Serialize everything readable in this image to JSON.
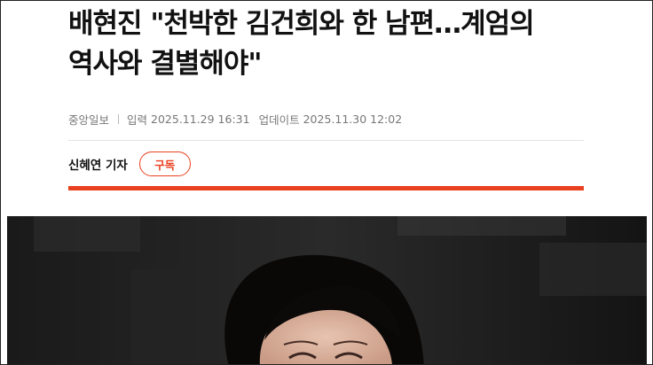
{
  "article": {
    "headline_line1": "배현진 \"천박한 김건희와 한 남편…계엄의",
    "headline_line2": "역사와 결별해야\"",
    "source": "중앙일보",
    "input_label": "입력",
    "input_time": "2025.11.29 16:31",
    "update_label": "업데이트",
    "update_time": "2025.11.30 12:02",
    "reporter": "신혜연 기자",
    "subscribe_label": "구독"
  },
  "colors": {
    "accent": "#e9401f",
    "photo_background": "#151515"
  },
  "photo": {
    "subject": "smiling-woman-photo"
  }
}
